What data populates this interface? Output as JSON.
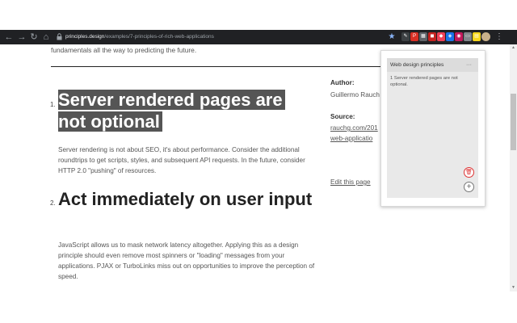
{
  "browser": {
    "url_domain": "principles.design",
    "url_path": "/examples/7-principles-of-rich-web-applications",
    "back_icon": "arrow-left",
    "forward_icon": "arrow-right",
    "reload_icon": "reload",
    "home_icon": "home",
    "extensions": [
      {
        "name": "ext-pen",
        "color": "#3c4043",
        "glyph": "✎"
      },
      {
        "name": "ext-pinterest",
        "color": "#d93025",
        "glyph": "P"
      },
      {
        "name": "ext-grid",
        "color": "#5f6368",
        "glyph": "▦"
      },
      {
        "name": "ext-red",
        "color": "#c5221f",
        "glyph": "◼"
      },
      {
        "name": "ext-pocket",
        "color": "#ef4056",
        "glyph": "◆"
      },
      {
        "name": "ext-shield",
        "color": "#1a73e8",
        "glyph": "◈"
      },
      {
        "name": "ext-magenta",
        "color": "#c2185b",
        "glyph": "◉"
      },
      {
        "name": "ext-folder",
        "color": "#80868b",
        "glyph": "▭"
      },
      {
        "name": "ext-notes",
        "color": "#f9d71c",
        "glyph": "▤"
      }
    ]
  },
  "page": {
    "intro": "fundamentals all the way to predicting the future.",
    "section1": {
      "number": "1.",
      "title_line1": "Server rendered pages are",
      "title_line2": "not optional",
      "body": "Server rendering is not about SEO, it's about performance. Consider the additional roundtrips to get scripts, styles, and subsequent API requests. In the future, consider HTTP 2.0 \"pushing\" of resources."
    },
    "section2": {
      "number": "2.",
      "title": "Act immediately on user input",
      "body": "JavaScript allows us to mask network latency altogether. Applying this as a design principle should even remove most spinners or \"loading\" messages from your applications. PJAX or TurboLinks miss out on opportunities to improve the perception of speed."
    },
    "sidebar": {
      "author_label": "Author:",
      "author_value": "Guillermo Rauch",
      "source_label": "Source:",
      "source_line1": "rauchg.com/201",
      "source_line2": "web-applicatio",
      "edit_link": "Edit this page"
    }
  },
  "popup": {
    "title": "Web design principles",
    "more_label": "···",
    "note": "1 Server rendered pages are not optional.",
    "delete_icon": "trash",
    "add_icon": "plus"
  }
}
